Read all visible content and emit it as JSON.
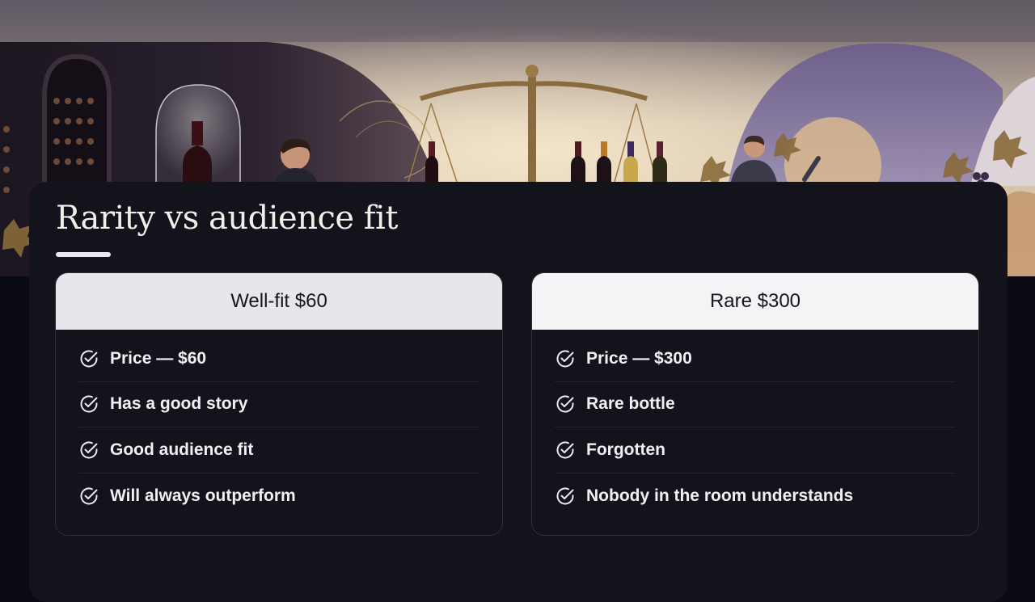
{
  "slide": {
    "title": "Rarity vs audience fit",
    "colors": {
      "background": "#0b0b14",
      "card": "#13131c",
      "panel_header": "#e6e7eb",
      "text": "#f1f1f4",
      "check_icon": "#e9e9ee"
    }
  },
  "comparison": {
    "left": {
      "header": "Well-fit $60",
      "items": [
        {
          "text": "Price — $60",
          "icon": "check-circle-icon"
        },
        {
          "text": "Has a good story",
          "icon": "check-circle-icon"
        },
        {
          "text": "Good audience fit",
          "icon": "check-circle-icon"
        },
        {
          "text": "Will always outperform",
          "icon": "check-circle-icon"
        }
      ]
    },
    "right": {
      "header": "Rare $300",
      "items": [
        {
          "text": "Price — $300",
          "icon": "check-circle-icon"
        },
        {
          "text": "Rare bottle",
          "icon": "check-circle-icon"
        },
        {
          "text": "Forgotten",
          "icon": "check-circle-icon"
        },
        {
          "text": "Nobody in the room understands",
          "icon": "check-circle-icon"
        }
      ]
    }
  }
}
